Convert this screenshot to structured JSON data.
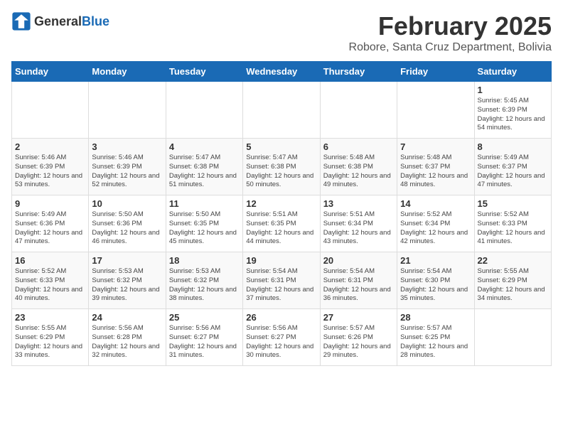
{
  "header": {
    "logo_general": "General",
    "logo_blue": "Blue",
    "title": "February 2025",
    "subtitle": "Robore, Santa Cruz Department, Bolivia"
  },
  "calendar": {
    "weekdays": [
      "Sunday",
      "Monday",
      "Tuesday",
      "Wednesday",
      "Thursday",
      "Friday",
      "Saturday"
    ],
    "weeks": [
      [
        {
          "day": "",
          "info": ""
        },
        {
          "day": "",
          "info": ""
        },
        {
          "day": "",
          "info": ""
        },
        {
          "day": "",
          "info": ""
        },
        {
          "day": "",
          "info": ""
        },
        {
          "day": "",
          "info": ""
        },
        {
          "day": "1",
          "info": "Sunrise: 5:45 AM\nSunset: 6:39 PM\nDaylight: 12 hours\nand 54 minutes."
        }
      ],
      [
        {
          "day": "2",
          "info": "Sunrise: 5:46 AM\nSunset: 6:39 PM\nDaylight: 12 hours\nand 53 minutes."
        },
        {
          "day": "3",
          "info": "Sunrise: 5:46 AM\nSunset: 6:39 PM\nDaylight: 12 hours\nand 52 minutes."
        },
        {
          "day": "4",
          "info": "Sunrise: 5:47 AM\nSunset: 6:38 PM\nDaylight: 12 hours\nand 51 minutes."
        },
        {
          "day": "5",
          "info": "Sunrise: 5:47 AM\nSunset: 6:38 PM\nDaylight: 12 hours\nand 50 minutes."
        },
        {
          "day": "6",
          "info": "Sunrise: 5:48 AM\nSunset: 6:38 PM\nDaylight: 12 hours\nand 49 minutes."
        },
        {
          "day": "7",
          "info": "Sunrise: 5:48 AM\nSunset: 6:37 PM\nDaylight: 12 hours\nand 48 minutes."
        },
        {
          "day": "8",
          "info": "Sunrise: 5:49 AM\nSunset: 6:37 PM\nDaylight: 12 hours\nand 47 minutes."
        }
      ],
      [
        {
          "day": "9",
          "info": "Sunrise: 5:49 AM\nSunset: 6:36 PM\nDaylight: 12 hours\nand 47 minutes."
        },
        {
          "day": "10",
          "info": "Sunrise: 5:50 AM\nSunset: 6:36 PM\nDaylight: 12 hours\nand 46 minutes."
        },
        {
          "day": "11",
          "info": "Sunrise: 5:50 AM\nSunset: 6:35 PM\nDaylight: 12 hours\nand 45 minutes."
        },
        {
          "day": "12",
          "info": "Sunrise: 5:51 AM\nSunset: 6:35 PM\nDaylight: 12 hours\nand 44 minutes."
        },
        {
          "day": "13",
          "info": "Sunrise: 5:51 AM\nSunset: 6:34 PM\nDaylight: 12 hours\nand 43 minutes."
        },
        {
          "day": "14",
          "info": "Sunrise: 5:52 AM\nSunset: 6:34 PM\nDaylight: 12 hours\nand 42 minutes."
        },
        {
          "day": "15",
          "info": "Sunrise: 5:52 AM\nSunset: 6:33 PM\nDaylight: 12 hours\nand 41 minutes."
        }
      ],
      [
        {
          "day": "16",
          "info": "Sunrise: 5:52 AM\nSunset: 6:33 PM\nDaylight: 12 hours\nand 40 minutes."
        },
        {
          "day": "17",
          "info": "Sunrise: 5:53 AM\nSunset: 6:32 PM\nDaylight: 12 hours\nand 39 minutes."
        },
        {
          "day": "18",
          "info": "Sunrise: 5:53 AM\nSunset: 6:32 PM\nDaylight: 12 hours\nand 38 minutes."
        },
        {
          "day": "19",
          "info": "Sunrise: 5:54 AM\nSunset: 6:31 PM\nDaylight: 12 hours\nand 37 minutes."
        },
        {
          "day": "20",
          "info": "Sunrise: 5:54 AM\nSunset: 6:31 PM\nDaylight: 12 hours\nand 36 minutes."
        },
        {
          "day": "21",
          "info": "Sunrise: 5:54 AM\nSunset: 6:30 PM\nDaylight: 12 hours\nand 35 minutes."
        },
        {
          "day": "22",
          "info": "Sunrise: 5:55 AM\nSunset: 6:29 PM\nDaylight: 12 hours\nand 34 minutes."
        }
      ],
      [
        {
          "day": "23",
          "info": "Sunrise: 5:55 AM\nSunset: 6:29 PM\nDaylight: 12 hours\nand 33 minutes."
        },
        {
          "day": "24",
          "info": "Sunrise: 5:56 AM\nSunset: 6:28 PM\nDaylight: 12 hours\nand 32 minutes."
        },
        {
          "day": "25",
          "info": "Sunrise: 5:56 AM\nSunset: 6:27 PM\nDaylight: 12 hours\nand 31 minutes."
        },
        {
          "day": "26",
          "info": "Sunrise: 5:56 AM\nSunset: 6:27 PM\nDaylight: 12 hours\nand 30 minutes."
        },
        {
          "day": "27",
          "info": "Sunrise: 5:57 AM\nSunset: 6:26 PM\nDaylight: 12 hours\nand 29 minutes."
        },
        {
          "day": "28",
          "info": "Sunrise: 5:57 AM\nSunset: 6:25 PM\nDaylight: 12 hours\nand 28 minutes."
        },
        {
          "day": "",
          "info": ""
        }
      ]
    ]
  }
}
